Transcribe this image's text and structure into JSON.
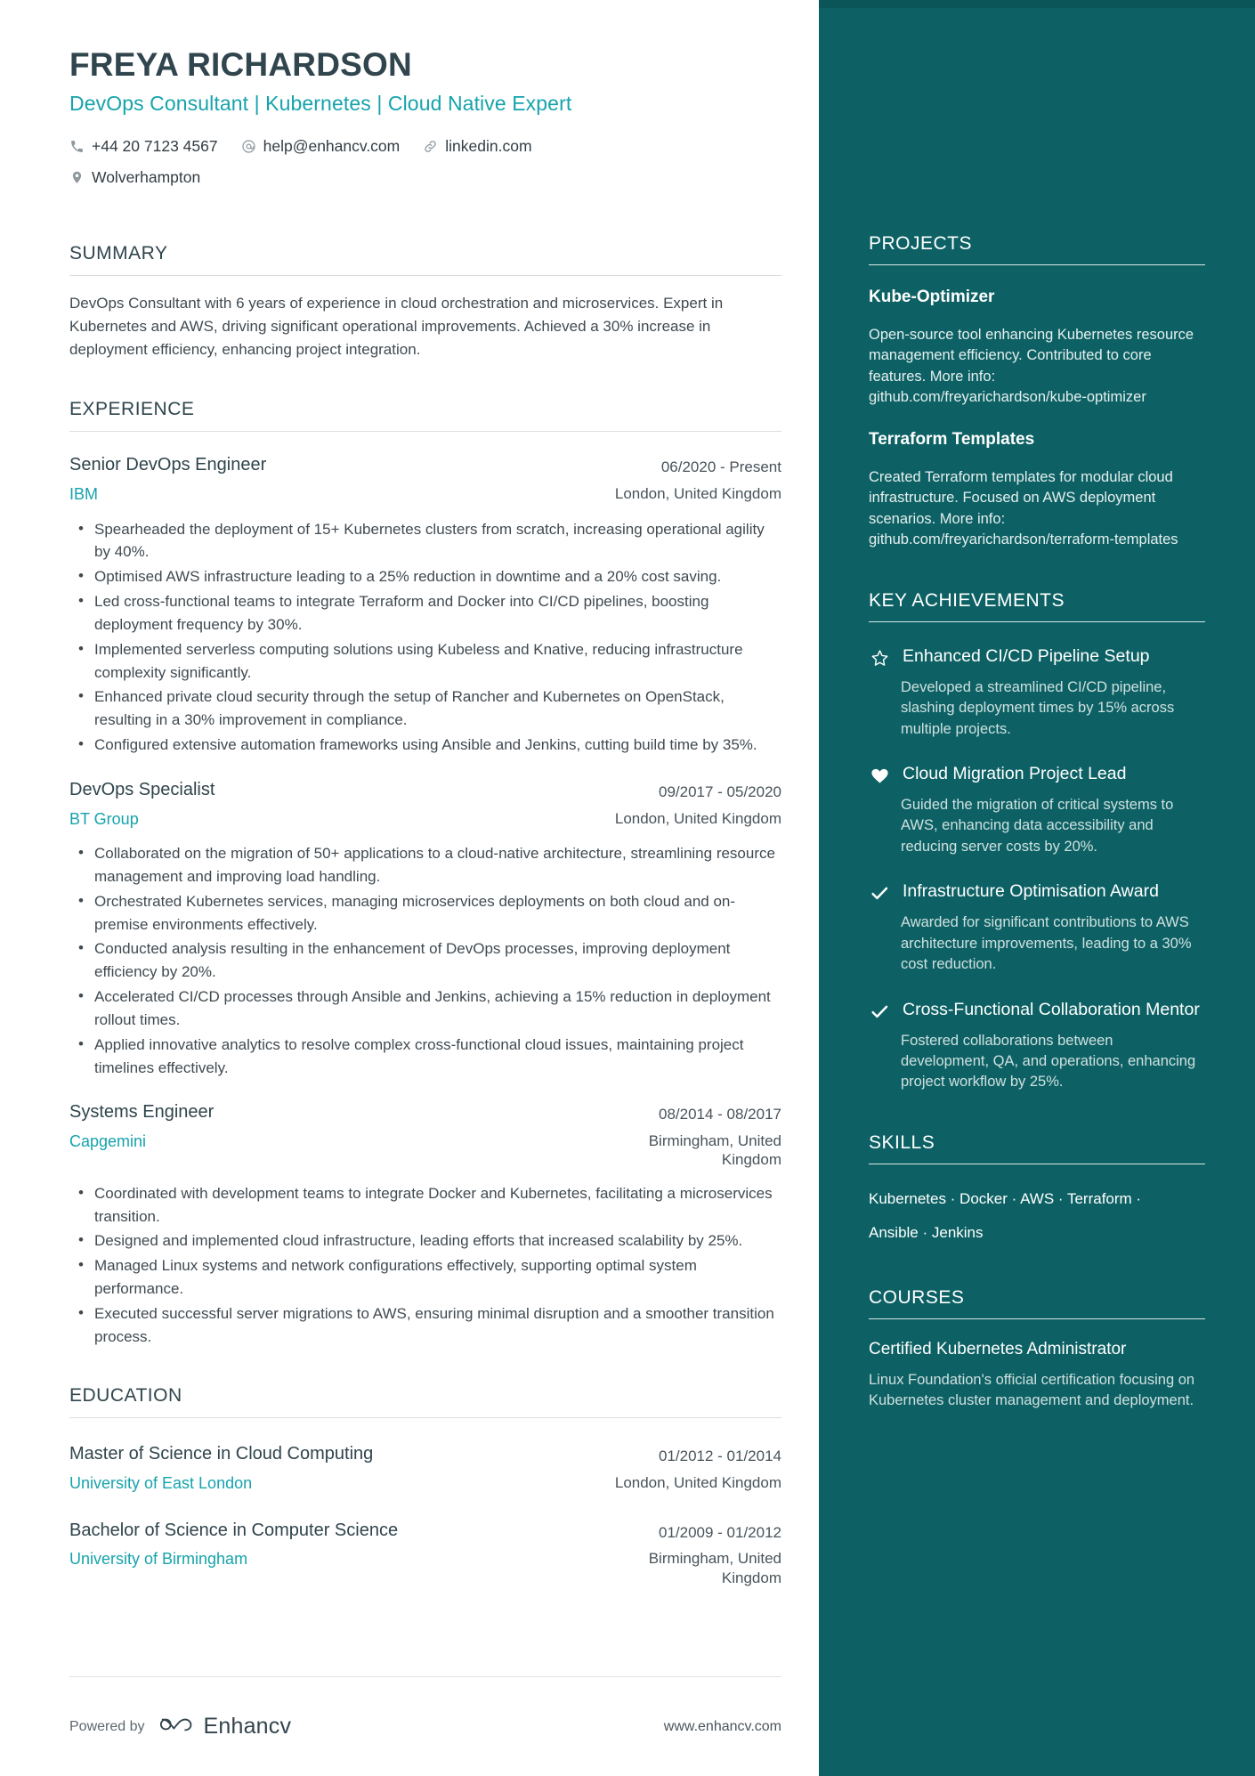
{
  "colors": {
    "accent_teal": "#16a3ac",
    "sidebar_bg": "#0d6164",
    "heading": "#30454d",
    "body_text": "#404a51"
  },
  "header": {
    "name": "FREYA RICHARDSON",
    "headline": "DevOps Consultant | Kubernetes | Cloud Native Expert",
    "contacts": [
      {
        "icon": "phone-icon",
        "text": "+44 20 7123 4567"
      },
      {
        "icon": "email-icon",
        "text": "help@enhancv.com"
      },
      {
        "icon": "link-icon",
        "text": "linkedin.com"
      },
      {
        "icon": "location-icon",
        "text": "Wolverhampton"
      }
    ]
  },
  "summary": {
    "title": "SUMMARY",
    "text": "DevOps Consultant with 6 years of experience in cloud orchestration and microservices. Expert in Kubernetes and AWS, driving significant operational improvements. Achieved a 30% increase in deployment efficiency, enhancing project integration."
  },
  "experience": {
    "title": "EXPERIENCE",
    "entries": [
      {
        "role": "Senior DevOps Engineer",
        "dates": "06/2020 - Present",
        "company": "IBM",
        "location": "London, United Kingdom",
        "bullets": [
          "Spearheaded the deployment of 15+ Kubernetes clusters from scratch, increasing operational agility by 40%.",
          "Optimised AWS infrastructure leading to a 25% reduction in downtime and a 20% cost saving.",
          "Led cross-functional teams to integrate Terraform and Docker into CI/CD pipelines, boosting deployment frequency by 30%.",
          "Implemented serverless computing solutions using Kubeless and Knative, reducing infrastructure complexity significantly.",
          "Enhanced private cloud security through the setup of Rancher and Kubernetes on OpenStack, resulting in a 30% improvement in compliance.",
          "Configured extensive automation frameworks using Ansible and Jenkins, cutting build time by 35%."
        ]
      },
      {
        "role": "DevOps Specialist",
        "dates": "09/2017 - 05/2020",
        "company": "BT Group",
        "location": "London, United Kingdom",
        "bullets": [
          "Collaborated on the migration of 50+ applications to a cloud-native architecture, streamlining resource management and improving load handling.",
          "Orchestrated Kubernetes services, managing microservices deployments on both cloud and on-premise environments effectively.",
          "Conducted analysis resulting in the enhancement of DevOps processes, improving deployment efficiency by 20%.",
          "Accelerated CI/CD processes through Ansible and Jenkins, achieving a 15% reduction in deployment rollout times.",
          "Applied innovative analytics to resolve complex cross-functional cloud issues, maintaining project timelines effectively."
        ]
      },
      {
        "role": "Systems Engineer",
        "dates": "08/2014 - 08/2017",
        "company": "Capgemini",
        "location": "Birmingham, United Kingdom",
        "bullets": [
          "Coordinated with development teams to integrate Docker and Kubernetes, facilitating a microservices transition.",
          "Designed and implemented cloud infrastructure, leading efforts that increased scalability by 25%.",
          "Managed Linux systems and network configurations effectively, supporting optimal system performance.",
          "Executed successful server migrations to AWS, ensuring minimal disruption and a smoother transition process."
        ]
      }
    ]
  },
  "education": {
    "title": "EDUCATION",
    "entries": [
      {
        "degree": "Master of Science in Cloud Computing",
        "dates": "01/2012 - 01/2014",
        "school": "University of East London",
        "location": "London, United Kingdom"
      },
      {
        "degree": "Bachelor of Science in Computer Science",
        "dates": "01/2009 - 01/2012",
        "school": "University of Birmingham",
        "location": "Birmingham, United Kingdom"
      }
    ]
  },
  "projects": {
    "title": "PROJECTS",
    "items": [
      {
        "name": "Kube-Optimizer",
        "description": "Open-source tool enhancing Kubernetes resource management efficiency. Contributed to core features. More info: github.com/freyarichardson/kube-optimizer"
      },
      {
        "name": "Terraform Templates",
        "description": "Created Terraform templates for modular cloud infrastructure. Focused on AWS deployment scenarios. More info: github.com/freyarichardson/terraform-templates"
      }
    ]
  },
  "achievements": {
    "title": "KEY ACHIEVEMENTS",
    "items": [
      {
        "icon": "star-icon",
        "title": "Enhanced CI/CD Pipeline Setup",
        "description": "Developed a streamlined CI/CD pipeline, slashing deployment times by 15% across multiple projects."
      },
      {
        "icon": "heart-icon",
        "title": "Cloud Migration Project Lead",
        "description": "Guided the migration of critical systems to AWS, enhancing data accessibility and reducing server costs by 20%."
      },
      {
        "icon": "check-icon",
        "title": "Infrastructure Optimisation Award",
        "description": "Awarded for significant contributions to AWS architecture improvements, leading to a 30% cost reduction."
      },
      {
        "icon": "check-icon",
        "title": "Cross-Functional Collaboration Mentor",
        "description": "Fostered collaborations between development, QA, and operations, enhancing project workflow by 25%."
      }
    ]
  },
  "skills": {
    "title": "SKILLS",
    "line1": "Kubernetes · Docker · AWS · Terraform ·",
    "line2": "Ansible · Jenkins"
  },
  "courses": {
    "title": "COURSES",
    "items": [
      {
        "name": "Certified Kubernetes Administrator",
        "description": "Linux Foundation's official certification focusing on Kubernetes cluster management and deployment."
      }
    ]
  },
  "footer": {
    "powered_by": "Powered by",
    "brand": "Enhancv",
    "url": "www.enhancv.com"
  }
}
